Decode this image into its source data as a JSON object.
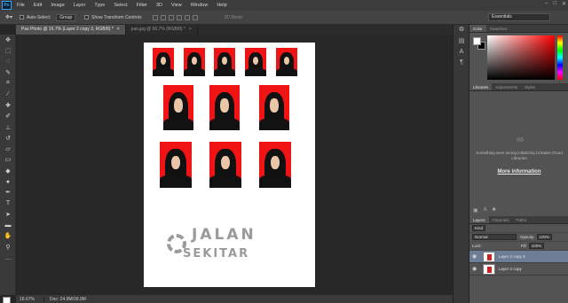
{
  "app": {
    "logo": "Ps"
  },
  "menu": [
    "File",
    "Edit",
    "Image",
    "Layer",
    "Type",
    "Select",
    "Filter",
    "3D",
    "View",
    "Window",
    "Help"
  ],
  "options": {
    "auto_select_label": "Auto-Select:",
    "auto_select_value": "Group",
    "show_transform_label": "Show Transform Controls",
    "mode_3d": "3D Mode:",
    "workspace": "Essentials"
  },
  "tabs": [
    {
      "label": "Pas Photo @ 16.7% (Layer 2 copy 3, RGB/8) *",
      "active": true
    },
    {
      "label": "pas.jpg @ 66.7% (RGB/8) *",
      "active": false
    }
  ],
  "watermark": {
    "line1": "JALAN",
    "line2": "SEKITAR"
  },
  "status": {
    "zoom": "16.67%",
    "doc": "Doc: 24.9M/39.9M"
  },
  "color_panel": {
    "tabs": [
      "Color",
      "Swatches"
    ]
  },
  "libraries": {
    "tabs": [
      "Libraries",
      "Adjustments",
      "Styles"
    ],
    "message": "Something went wrong initializing Creative Cloud Libraries",
    "link": "More information"
  },
  "layers": {
    "tabs": [
      "Layers",
      "Channels",
      "Paths"
    ],
    "kind": "Kind",
    "blend_mode": "Normal",
    "opacity_label": "Opacity:",
    "opacity_value": "100%",
    "lock_label": "Lock:",
    "fill_label": "Fill:",
    "fill_value": "100%",
    "items": [
      {
        "name": "Layer 2 copy 3",
        "selected": true
      },
      {
        "name": "Layer 2 copy",
        "selected": false
      }
    ]
  }
}
